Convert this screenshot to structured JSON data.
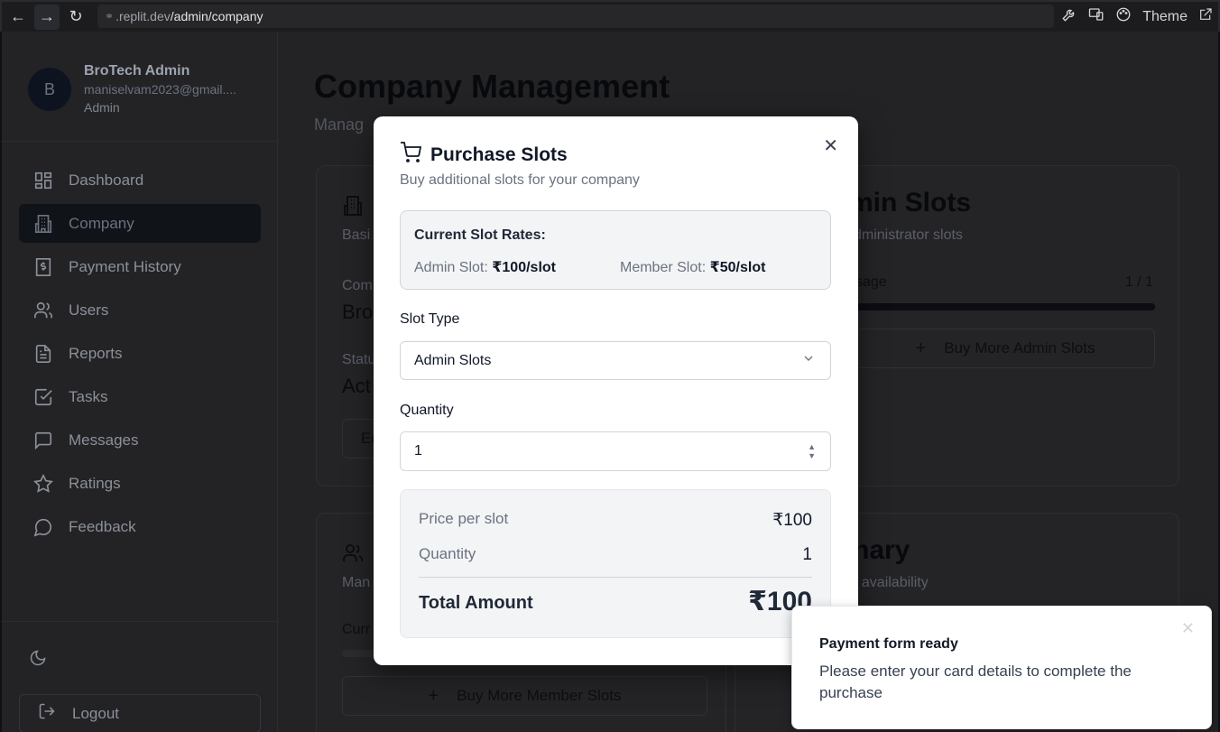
{
  "browser": {
    "url_host": ".replit.dev",
    "url_path": "/admin/company",
    "theme_label": "Theme"
  },
  "sidebar": {
    "avatar_initial": "B",
    "user_name": "BroTech Admin",
    "user_email": "maniselvam2023@gmail....",
    "user_role": "Admin",
    "items": [
      {
        "label": "Dashboard",
        "icon": "dashboard-icon"
      },
      {
        "label": "Company",
        "icon": "building-icon",
        "active": true
      },
      {
        "label": "Payment History",
        "icon": "receipt-icon"
      },
      {
        "label": "Users",
        "icon": "users-icon"
      },
      {
        "label": "Reports",
        "icon": "file-icon"
      },
      {
        "label": "Tasks",
        "icon": "check-square-icon"
      },
      {
        "label": "Messages",
        "icon": "message-square-icon"
      },
      {
        "label": "Ratings",
        "icon": "star-icon"
      },
      {
        "label": "Feedback",
        "icon": "message-circle-icon"
      }
    ],
    "logout_label": "Logout"
  },
  "main": {
    "title": "Company Management",
    "subtitle_visible": "Manag",
    "company_card": {
      "sub_visible": "Basi",
      "field1_label_visible": "Com",
      "field1_value_visible": "Bro",
      "field2_label_visible": "Statu",
      "field2_value_visible": "Act",
      "button_visible": "Ed"
    },
    "admin_slots_card": {
      "title_visible": "min Slots",
      "sub_visible": "dministrator slots",
      "usage_label_visible": "sage",
      "usage_value": "1 / 1",
      "usage_fraction": 1.0,
      "button_label": "Buy More Admin Slots"
    },
    "member_card": {
      "sub_visible": "Man",
      "current_visible": "Curr",
      "button_label": "Buy More Member Slots"
    },
    "summary_card": {
      "title_visible": "nary",
      "sub_visible": "t availability"
    }
  },
  "modal": {
    "title": "Purchase Slots",
    "description": "Buy additional slots for your company",
    "rates_title": "Current Slot Rates:",
    "admin_rate_label": "Admin Slot:",
    "admin_rate_value": "₹100/slot",
    "member_rate_label": "Member Slot:",
    "member_rate_value": "₹50/slot",
    "slot_type_label": "Slot Type",
    "slot_type_value": "Admin Slots",
    "quantity_label": "Quantity",
    "quantity_value": "1",
    "price_per_slot_label": "Price per slot",
    "price_per_slot_value": "₹100",
    "summary_quantity_label": "Quantity",
    "summary_quantity_value": "1",
    "total_label": "Total Amount",
    "total_value": "₹100"
  },
  "toast": {
    "title": "Payment form ready",
    "body": "Please enter your card details to complete the purchase"
  }
}
